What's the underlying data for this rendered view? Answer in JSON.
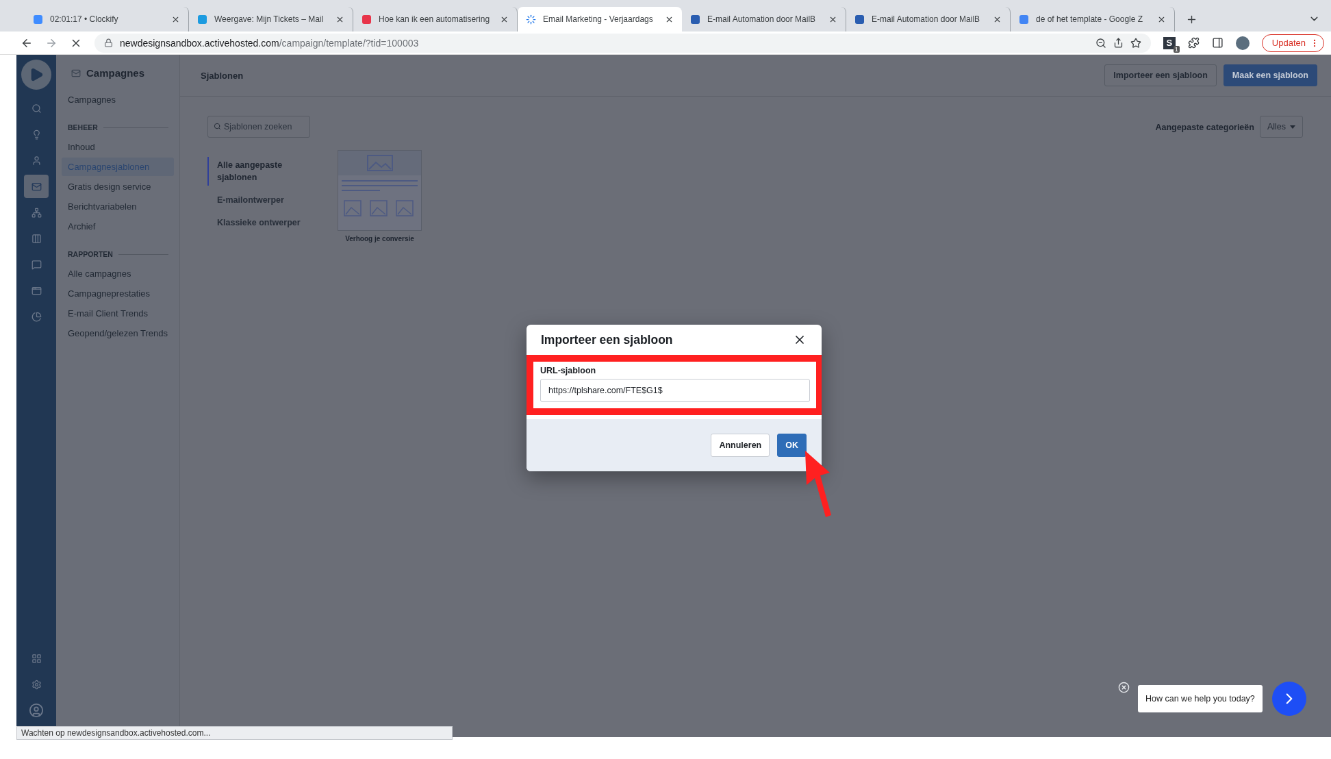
{
  "browser": {
    "tabs": [
      {
        "title": "02:01:17 • Clockify",
        "selected": false
      },
      {
        "title": "Weergave: Mijn Tickets – Mail",
        "selected": false
      },
      {
        "title": "Hoe kan ik een automatisering",
        "selected": false
      },
      {
        "title": "Email Marketing - Verjaardags",
        "selected": true
      },
      {
        "title": "E-mail Automation door MailB",
        "selected": false
      },
      {
        "title": "E-mail Automation door MailB",
        "selected": false
      },
      {
        "title": "de of het template - Google Z",
        "selected": false
      }
    ],
    "address": {
      "host": "newdesignsandbox.activehosted.com",
      "path": "/campaign/template/?tid=100003"
    },
    "extension_letter": "S",
    "extension_badge": "1",
    "update_button": "Updaten",
    "status_text": "Wachten op newdesignsandbox.activehosted.com..."
  },
  "rail": {
    "items": [
      {
        "selected": false
      },
      {
        "selected": false
      },
      {
        "selected": false
      },
      {
        "selected": true
      },
      {
        "selected": false
      },
      {
        "selected": false
      },
      {
        "selected": false
      },
      {
        "selected": false
      },
      {
        "selected": false
      }
    ]
  },
  "subnav": {
    "title": "Campagnes",
    "sections": [
      {
        "items": [
          {
            "label": "Campagnes",
            "selected": false
          }
        ]
      },
      {
        "heading": "BEHEER",
        "items": [
          {
            "label": "Inhoud",
            "selected": false
          },
          {
            "label": "Campagnesjablonen",
            "selected": true
          },
          {
            "label": "Gratis design service",
            "selected": false
          },
          {
            "label": "Berichtvariabelen",
            "selected": false
          },
          {
            "label": "Archief",
            "selected": false
          }
        ]
      },
      {
        "heading": "RAPPORTEN",
        "items": [
          {
            "label": "Alle campagnes",
            "selected": false
          },
          {
            "label": "Campagneprestaties",
            "selected": false
          },
          {
            "label": "E-mail Client Trends",
            "selected": false
          },
          {
            "label": "Geopend/gelezen Trends",
            "selected": false
          }
        ]
      }
    ]
  },
  "header": {
    "title": "Sjablonen",
    "buttons": [
      {
        "label": "Importeer een sjabloon",
        "kind": "secondary"
      },
      {
        "label": "Maak een sjabloon",
        "kind": "primary"
      }
    ]
  },
  "search": {
    "placeholder": "Sjablonen zoeken"
  },
  "filter": {
    "label": "Aangepaste categorieën",
    "value": "Alles"
  },
  "categories": [
    {
      "label": "Alle aangepaste sjablonen",
      "selected": true
    },
    {
      "label": "E-mailontwerper",
      "selected": false
    },
    {
      "label": "Klassieke ontwerper",
      "selected": false
    }
  ],
  "templates": [
    {
      "caption": "Verhoog je conversie"
    }
  ],
  "dialog": {
    "title": "Importeer een sjabloon",
    "field_label": "URL-sjabloon",
    "field_value": "https://tplshare.com/FTE$G1$",
    "buttons": [
      {
        "label": "Annuleren",
        "kind": "secondary"
      },
      {
        "label": "OK",
        "kind": "primary"
      }
    ]
  },
  "chat": {
    "prompt": "How can we help you today?"
  }
}
